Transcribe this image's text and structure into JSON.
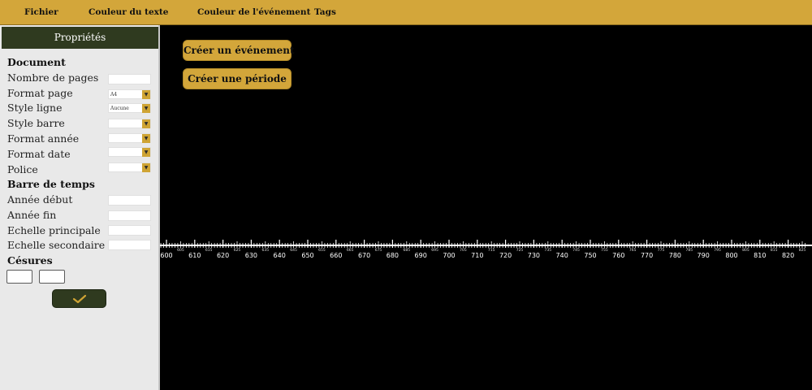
{
  "menu": {
    "file": "Fichier",
    "text_color": "Couleur du texte",
    "event_color": "Couleur de l'événement",
    "tags": "Tags"
  },
  "panel": {
    "title": "Propriétés",
    "document": {
      "heading": "Document",
      "pages_label": "Nombre de pages",
      "pages_value": "",
      "page_format_label": "Format page",
      "page_format_value": "A4",
      "line_style_label": "Style ligne",
      "line_style_value": "Aucune",
      "bar_style_label": "Style barre",
      "bar_style_value": "",
      "year_format_label": "Format année",
      "year_format_value": "",
      "date_format_label": "Format date",
      "date_format_value": "",
      "font_label": "Police",
      "font_value": ""
    },
    "timebar": {
      "heading": "Barre de temps",
      "start_year_label": "Année début",
      "start_year_value": "",
      "end_year_label": "Année fin",
      "end_year_value": "",
      "main_scale_label": "Echelle principale",
      "main_scale_value": "",
      "secondary_scale_label": "Echelle secondaire",
      "secondary_scale_value": ""
    },
    "cesures": {
      "heading": "Césures"
    },
    "confirm_icon": "check-icon"
  },
  "canvas": {
    "create_event": "Créer un événement",
    "create_period": "Créer une période"
  },
  "timeline": {
    "start": 600,
    "end": 825,
    "major_step": 10,
    "minor_step": 5,
    "line_color": "#ffffff"
  },
  "colors": {
    "accent": "#d3a63a",
    "panel_header": "#2f3a1f",
    "panel_bg": "#e9e9e9",
    "canvas_bg": "#000000"
  }
}
